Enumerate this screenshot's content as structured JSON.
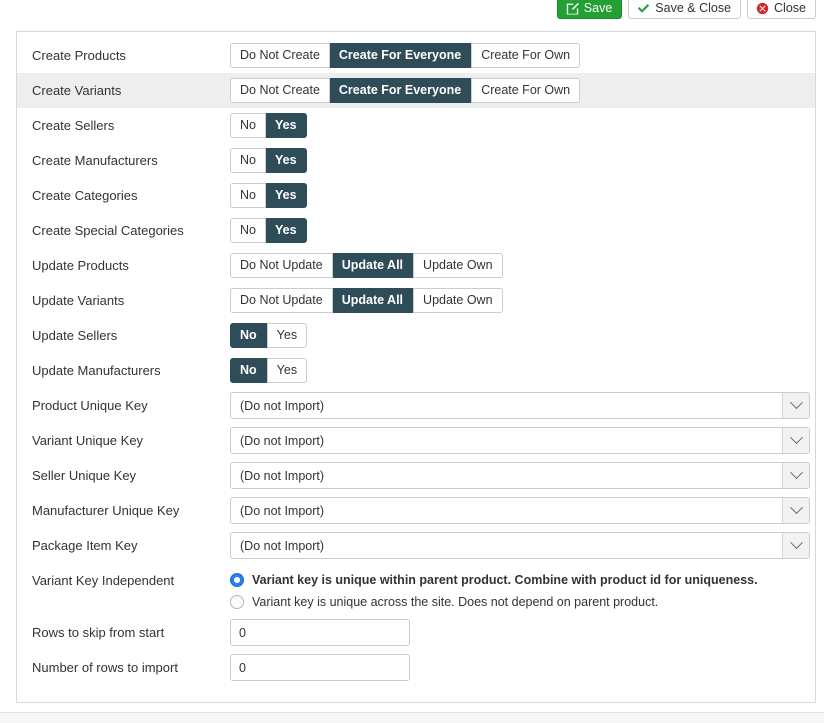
{
  "toolbar": {
    "buttons": [
      {
        "label": "Save",
        "icon": "save-edit-icon",
        "style": "primary"
      },
      {
        "label": "Save & Close",
        "icon": "check-icon",
        "style": "default"
      },
      {
        "label": "Close",
        "icon": "close-circle-icon",
        "style": "default"
      }
    ]
  },
  "colors": {
    "accent_dark": "#2e4d58",
    "save_green": "#22a033",
    "check_green": "#2f9e44",
    "close_red": "#cc2b2b",
    "radio_blue": "#2b7de9",
    "row_highlight": "#eeeeee"
  },
  "form": {
    "rows": [
      {
        "label": "Create Products",
        "type": "segmented",
        "highlighted": false,
        "options": [
          "Do Not Create",
          "Create For Everyone",
          "Create For Own"
        ],
        "selected": "Create For Everyone"
      },
      {
        "label": "Create Variants",
        "type": "segmented",
        "highlighted": true,
        "options": [
          "Do Not Create",
          "Create For Everyone",
          "Create For Own"
        ],
        "selected": "Create For Everyone"
      },
      {
        "label": "Create Sellers",
        "type": "segmented",
        "highlighted": false,
        "options": [
          "No",
          "Yes"
        ],
        "selected": "Yes"
      },
      {
        "label": "Create Manufacturers",
        "type": "segmented",
        "highlighted": false,
        "options": [
          "No",
          "Yes"
        ],
        "selected": "Yes"
      },
      {
        "label": "Create Categories",
        "type": "segmented",
        "highlighted": false,
        "options": [
          "No",
          "Yes"
        ],
        "selected": "Yes"
      },
      {
        "label": "Create Special Categories",
        "type": "segmented",
        "highlighted": false,
        "options": [
          "No",
          "Yes"
        ],
        "selected": "Yes"
      },
      {
        "label": "Update Products",
        "type": "segmented",
        "highlighted": false,
        "options": [
          "Do Not Update",
          "Update All",
          "Update Own"
        ],
        "selected": "Update All"
      },
      {
        "label": "Update Variants",
        "type": "segmented",
        "highlighted": false,
        "options": [
          "Do Not Update",
          "Update All",
          "Update Own"
        ],
        "selected": "Update All"
      },
      {
        "label": "Update Sellers",
        "type": "segmented",
        "highlighted": false,
        "options": [
          "No",
          "Yes"
        ],
        "selected": "No"
      },
      {
        "label": "Update Manufacturers",
        "type": "segmented",
        "highlighted": false,
        "options": [
          "No",
          "Yes"
        ],
        "selected": "No"
      },
      {
        "label": "Product Unique Key",
        "type": "select",
        "highlighted": false,
        "value": "(Do not Import)"
      },
      {
        "label": "Variant Unique Key",
        "type": "select",
        "highlighted": false,
        "value": "(Do not Import)"
      },
      {
        "label": "Seller Unique Key",
        "type": "select",
        "highlighted": false,
        "value": "(Do not Import)"
      },
      {
        "label": "Manufacturer Unique Key",
        "type": "select",
        "highlighted": false,
        "value": "(Do not Import)"
      },
      {
        "label": "Package Item Key",
        "type": "select",
        "highlighted": false,
        "value": "(Do not Import)"
      },
      {
        "label": "Variant Key Independent",
        "type": "radio",
        "highlighted": false,
        "options": [
          {
            "text": "Variant key is unique within parent product. Combine with product id for uniqueness.",
            "checked": true
          },
          {
            "text": "Variant key is unique across the site. Does not depend on parent product.",
            "checked": false
          }
        ]
      },
      {
        "label": "Rows to skip from start",
        "type": "text",
        "highlighted": false,
        "value": "0"
      },
      {
        "label": "Number of rows to import",
        "type": "text",
        "highlighted": false,
        "value": "0"
      }
    ]
  }
}
